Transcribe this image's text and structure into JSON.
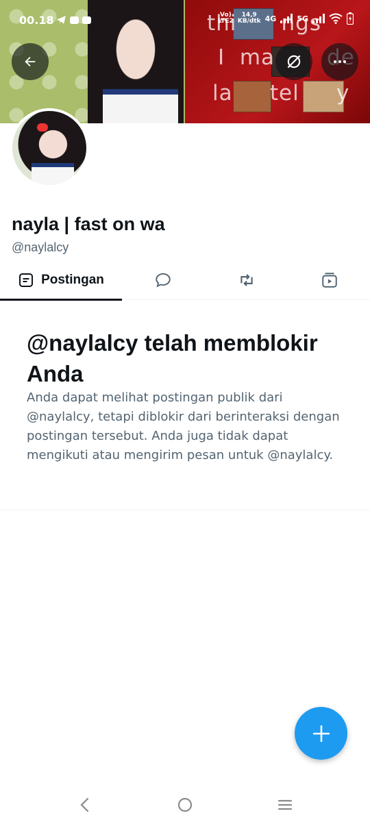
{
  "status_bar": {
    "time": "00.18",
    "network_volte": "Vo)",
    "network_lte": "LTE2",
    "speed_value": "14,9",
    "speed_unit": "KB/dtk",
    "sig1_label": "4G",
    "sig2_label": "5G"
  },
  "banner": {
    "line1": "thi      ngs",
    "line2": "I  ma       de",
    "line3": "la     tel     y"
  },
  "profile": {
    "display_name": "nayla | fast on wa",
    "handle": "@naylalcy"
  },
  "tabs": [
    {
      "label": "Postingan",
      "icon": "posts-icon",
      "selected": true
    },
    {
      "label": "",
      "icon": "replies-icon",
      "selected": false
    },
    {
      "label": "",
      "icon": "reposts-icon",
      "selected": false
    },
    {
      "label": "",
      "icon": "media-icon",
      "selected": false
    }
  ],
  "block_notice": {
    "title": "@naylalcy telah memblokir Anda",
    "description": "Anda dapat melihat postingan publik dari @naylalcy, tetapi diblokir dari berinteraksi dengan postingan tersebut. Anda juga tidak dapat mengikuti atau mengirim pesan untuk @naylalcy."
  },
  "colors": {
    "accent": "#1d9bf0",
    "text_primary": "#0f1419",
    "text_secondary": "#536471"
  }
}
